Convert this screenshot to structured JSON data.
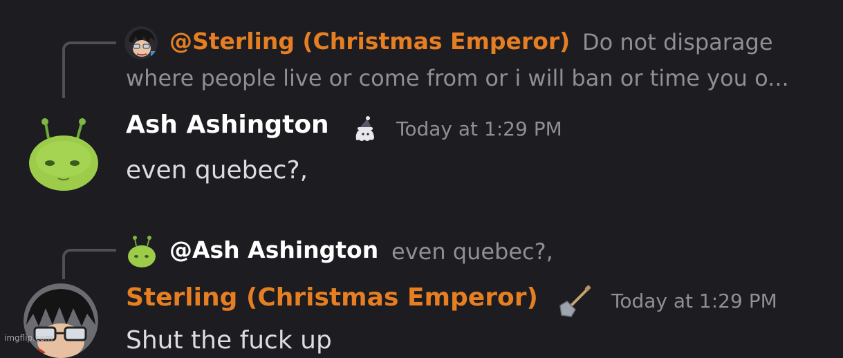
{
  "colors": {
    "background": "#1c1c21",
    "sterling_name": "#e67e22",
    "ash_name": "#ffffff",
    "muted_text": "#8e9096",
    "message_text": "#dcddde",
    "reply_line": "#4e5058"
  },
  "messages": [
    {
      "reply": {
        "mention": "@Sterling (Christmas Emperor)",
        "text_line1": "Do not disparage",
        "text_line2": "where people live or come from or i will ban or time you o..."
      },
      "author": "Ash Ashington",
      "author_badge_icon": "santa-hat-ghost-icon",
      "timestamp": "Today at 1:29 PM",
      "content": "even quebec?,",
      "avatar_icon": "green-alien-avatar"
    },
    {
      "reply": {
        "mention": "@Ash Ashington",
        "text_line1": "even quebec?,"
      },
      "author": "Sterling (Christmas Emperor)",
      "author_badge_icon": "shovel-icon",
      "timestamp": "Today at 1:29 PM",
      "content": "Shut the fuck up",
      "avatar_icon": "anime-character-avatar"
    }
  ],
  "watermark": "imgflip.com"
}
